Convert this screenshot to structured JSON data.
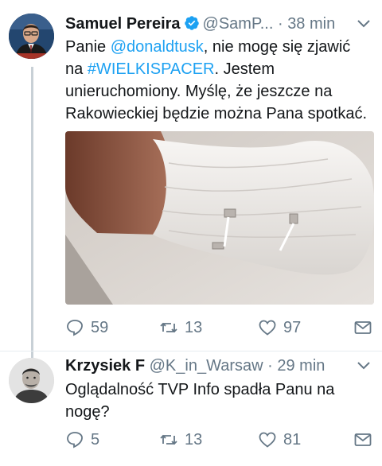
{
  "tweets": [
    {
      "author": {
        "name": "Samuel Pereira",
        "handle": "@SamP...",
        "verified": true
      },
      "separator": "·",
      "time": "38 min",
      "text": {
        "l1_pre": "Panie ",
        "l1_mention": "@donaldtusk",
        "l1_post": ", nie mogę się zjawić",
        "l2_pre": "na ",
        "l2_hashtag": "#WIELKISPACER",
        "l2_post": ". Jestem",
        "l3": "unieruchomiony. Myślę, że jeszcze na",
        "l4": "Rakowieckiej będzie można Pana spotkać."
      },
      "media": "photo-bandaged-leg",
      "actions": {
        "reply_count": "59",
        "retweet_count": "13",
        "like_count": "97"
      }
    },
    {
      "author": {
        "name": "Krzysiek F",
        "handle": "@K_in_Warsaw"
      },
      "separator": "·",
      "time": "29 min",
      "text": {
        "l1": "Oglądalność TVP Info spadła Panu na",
        "l2": "nogę?"
      },
      "actions": {
        "reply_count": "5",
        "retweet_count": "13",
        "like_count": "81"
      }
    }
  ],
  "colors": {
    "link": "#1da1f2",
    "secondary_text": "#657786",
    "thread_line": "#c8d0d6"
  },
  "icons": [
    "verified-badge-icon",
    "chevron-down-icon",
    "reply-icon",
    "retweet-icon",
    "like-icon",
    "direct-message-icon"
  ]
}
